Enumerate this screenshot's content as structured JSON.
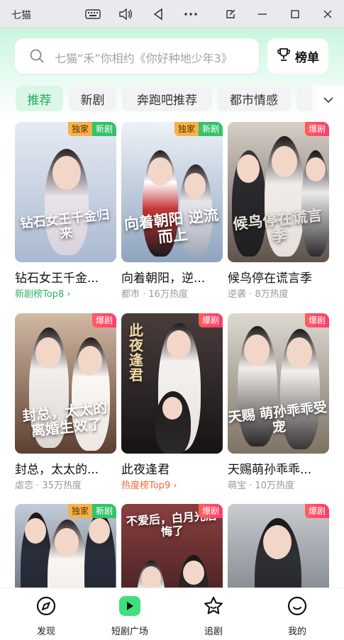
{
  "window": {
    "title": "七猫",
    "buttons": [
      "keyboard-icon",
      "volume-icon",
      "back-icon",
      "more-icon",
      "popout-icon",
      "minimize-icon",
      "maximize-icon",
      "close-icon"
    ]
  },
  "search": {
    "placeholder": "七猫“禾”你相约《你好种地少年3》",
    "rank_label": "榜单"
  },
  "tabs": [
    {
      "label": "推荐",
      "active": true
    },
    {
      "label": "新剧",
      "active": false
    },
    {
      "label": "奔跑吧推荐",
      "active": false
    },
    {
      "label": "都市情感",
      "active": false
    },
    {
      "label": "",
      "active": false
    }
  ],
  "badges": {
    "exclusive": "独家",
    "new": "新剧",
    "hot": "爆剧"
  },
  "cards": [
    {
      "title": "钻石女王千金...",
      "sub": "新剧榜Top8 ›",
      "poster_text": "钻石女王千金归来",
      "colors": [
        "#dfe6ef",
        "#b9c6d9"
      ]
    },
    {
      "title": "向着朝阳，逆...",
      "sub": "都市 · 16万热度",
      "poster_text": "向着朝阳 逆流而上",
      "colors": [
        "#e8eef5",
        "#9fb2c8"
      ]
    },
    {
      "title": "候鸟停在谎言季",
      "sub": "逆袭 · 8万热度",
      "poster_text": "候鸟停在谎言季",
      "colors": [
        "#cfc7be",
        "#6f625a"
      ]
    },
    {
      "title": "封总，太太的...",
      "sub": "虐恋 · 35万热度",
      "poster_text": "封总，太太的 离婚生效了",
      "colors": [
        "#c4aa95",
        "#6b4c3b"
      ]
    },
    {
      "title": "此夜逢君",
      "sub": "热度榜Top9 ›",
      "poster_text": "此夜逢君",
      "colors": [
        "#463a3a",
        "#1e1a1c"
      ]
    },
    {
      "title": "天赐萌孙乖乖...",
      "sub": "萌宝 · 10万热度",
      "poster_text": "天赐 萌孙乖乖受宠",
      "colors": [
        "#d9d5cf",
        "#8d8273"
      ]
    },
    {
      "title": "",
      "sub": "",
      "poster_text": "",
      "colors": [
        "#b9c3cf",
        "#3c4150"
      ]
    },
    {
      "title": "",
      "sub": "",
      "poster_text": "不爱后，白月光后悔了",
      "colors": [
        "#7e3a3a",
        "#2a1416"
      ]
    },
    {
      "title": "",
      "sub": "",
      "poster_text": "",
      "colors": [
        "#c3c7cb",
        "#5f6670"
      ]
    }
  ],
  "bottom_nav": [
    {
      "label": "发现",
      "icon": "compass-icon"
    },
    {
      "label": "短剧广场",
      "icon": "play-icon",
      "active": true
    },
    {
      "label": "追剧",
      "icon": "star-icon"
    },
    {
      "label": "我的",
      "icon": "smile-icon"
    }
  ],
  "colors": {
    "accent": "#1faa5c",
    "hot": "#ff4d61",
    "exclusive": "#f4b24a"
  }
}
